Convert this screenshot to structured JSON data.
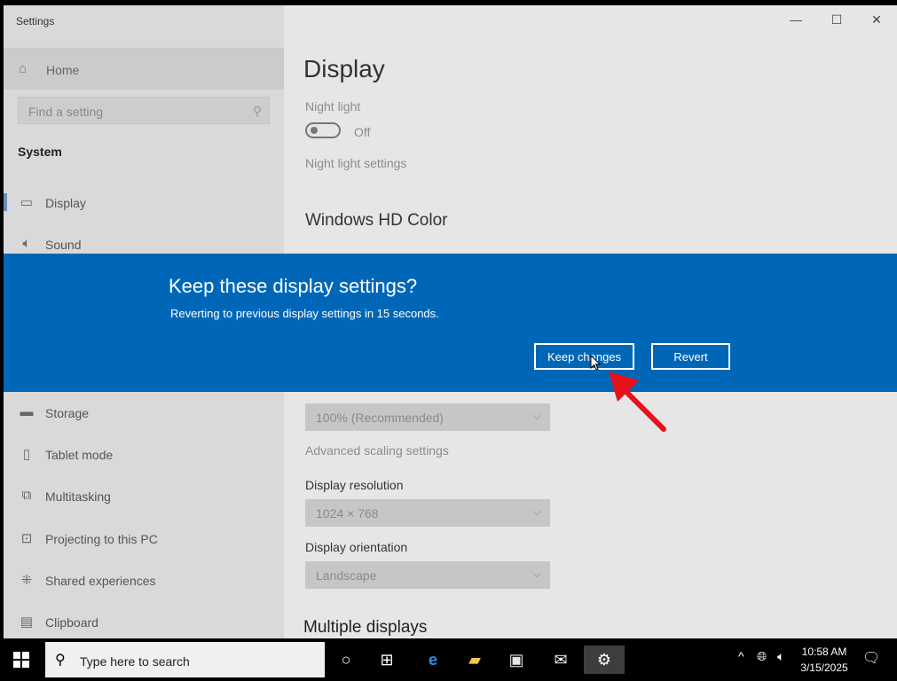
{
  "window": {
    "title": "Settings",
    "controls": {
      "minimize": "—",
      "maximize": "☐",
      "close": "✕"
    }
  },
  "sidebar": {
    "home_label": "Home",
    "search_placeholder": "Find a setting",
    "section_title": "System",
    "items": [
      {
        "label": "Display",
        "icon": "monitor-icon",
        "active": true
      },
      {
        "label": "Sound",
        "icon": "speaker-icon"
      },
      {
        "label": "Storage",
        "icon": "storage-icon"
      },
      {
        "label": "Tablet mode",
        "icon": "tablet-icon"
      },
      {
        "label": "Multitasking",
        "icon": "multitasking-icon"
      },
      {
        "label": "Projecting to this PC",
        "icon": "projecting-icon"
      },
      {
        "label": "Shared experiences",
        "icon": "shared-experiences-icon"
      },
      {
        "label": "Clipboard",
        "icon": "clipboard-icon"
      }
    ]
  },
  "main": {
    "title": "Display",
    "night_light_label": "Night light",
    "night_light_state": "Off",
    "night_light_settings": "Night light settings",
    "hd_color_heading": "Windows HD Color",
    "scale_value": "100% (Recommended)",
    "advanced_scaling": "Advanced scaling settings",
    "resolution_label": "Display resolution",
    "resolution_value": "1024 × 768",
    "orientation_label": "Display orientation",
    "orientation_value": "Landscape",
    "multiple_displays": "Multiple displays"
  },
  "dialog": {
    "title": "Keep these display settings?",
    "message": "Reverting to previous display settings in 15 seconds.",
    "keep_label": "Keep changes",
    "revert_label": "Revert",
    "accent_color": "#0067b8"
  },
  "taskbar": {
    "search_placeholder": "Type here to search",
    "time": "10:58 AM",
    "date": "3/15/2025"
  }
}
